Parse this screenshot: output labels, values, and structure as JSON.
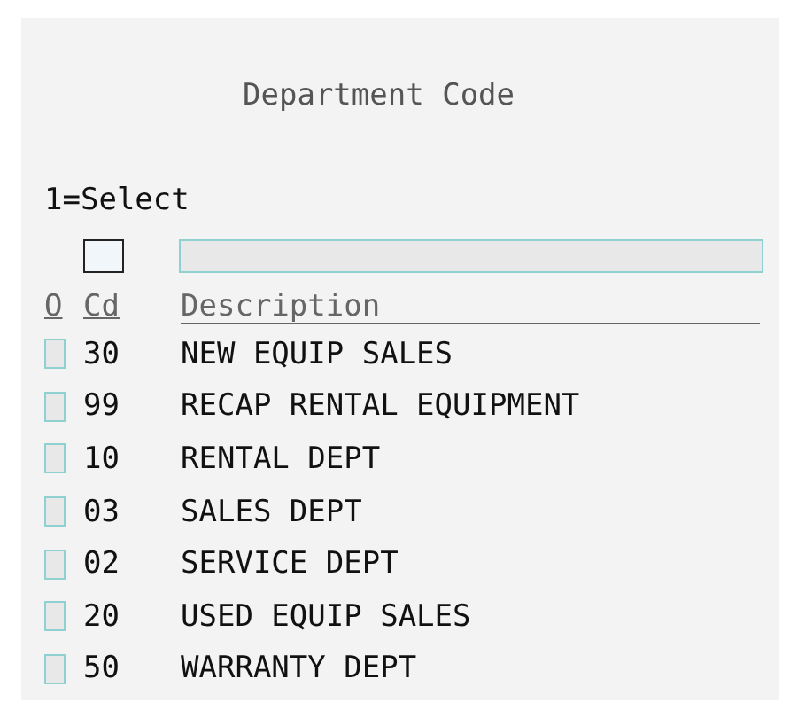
{
  "title": "Department Code",
  "instruction": "1=Select",
  "table": {
    "columns": [
      "O",
      "Cd",
      "Description"
    ],
    "rows": [
      {
        "code": "30",
        "description": "NEW EQUIP SALES"
      },
      {
        "code": "99",
        "description": "RECAP RENTAL EQUIPMENT"
      },
      {
        "code": "10",
        "description": "RENTAL DEPT"
      },
      {
        "code": "03",
        "description": "SALES DEPT"
      },
      {
        "code": "02",
        "description": "SERVICE DEPT"
      },
      {
        "code": "20",
        "description": "USED EQUIP SALES"
      },
      {
        "code": "50",
        "description": "WARRANTY DEPT"
      }
    ]
  }
}
